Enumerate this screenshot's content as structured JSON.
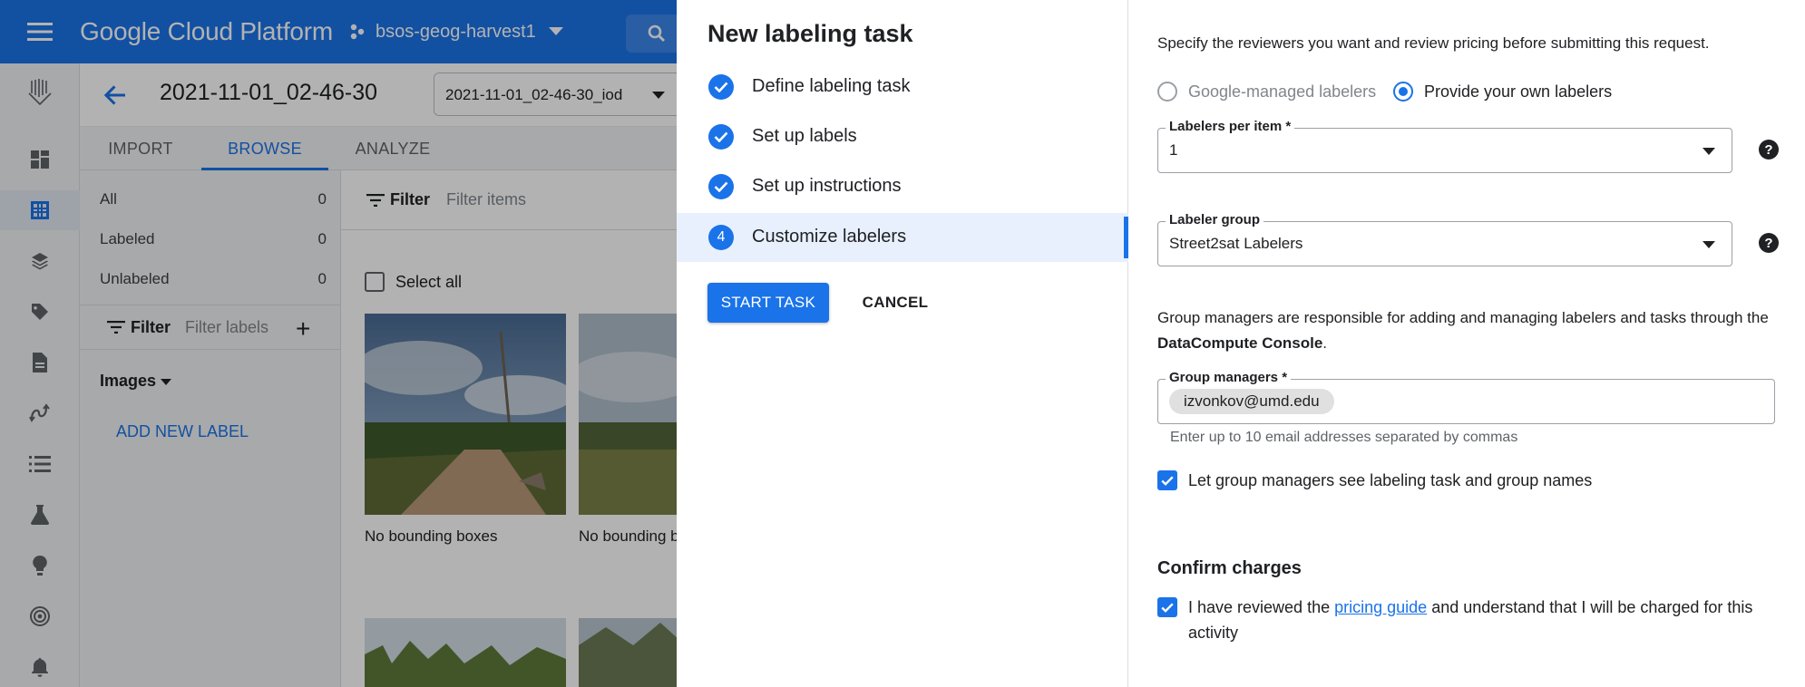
{
  "topbar": {
    "brand": "Google Cloud Platform",
    "project": "bsos-geog-harvest1"
  },
  "header": {
    "dataset_title": "2021-11-01_02-46-30",
    "dataset_select": "2021-11-01_02-46-30_iod"
  },
  "tabs": [
    {
      "label": "IMPORT"
    },
    {
      "label": "BROWSE"
    },
    {
      "label": "ANALYZE"
    }
  ],
  "counts": [
    {
      "label": "All",
      "value": "0"
    },
    {
      "label": "Labeled",
      "value": "0"
    },
    {
      "label": "Unlabeled",
      "value": "0"
    }
  ],
  "label_filter": {
    "title": "Filter",
    "placeholder": "Filter labels"
  },
  "images_label": "Images",
  "add_label": "ADD NEW LABEL",
  "content_filter": {
    "title": "Filter",
    "placeholder": "Filter items"
  },
  "select_all": "Select all",
  "captions": [
    "No bounding boxes",
    "No bounding b"
  ],
  "wizard": {
    "title": "New labeling task",
    "steps": [
      {
        "label": "Define labeling task"
      },
      {
        "label": "Set up labels"
      },
      {
        "label": "Set up instructions"
      },
      {
        "label": "Customize labelers",
        "number": "4"
      }
    ],
    "start": "START TASK",
    "cancel": "CANCEL"
  },
  "form": {
    "intro": "Specify the reviewers you want and review pricing before submitting this request.",
    "radio_google": "Google-managed labelers",
    "radio_own": "Provide your own labelers",
    "labelers_per_item": {
      "label": "Labelers per item *",
      "value": "1"
    },
    "labeler_group": {
      "label": "Labeler group",
      "value": "Street2sat Labelers"
    },
    "managers_text": "Group managers are responsible for adding and managing labelers and tasks through the",
    "managers_console": "DataCompute Console",
    "managers_end": ".",
    "group_managers": {
      "label": "Group managers *",
      "chip": "izvonkov@umd.edu"
    },
    "hint": "Enter up to 10 email addresses separated by commas",
    "let_managers": "Let group managers see labeling task and group names",
    "confirm_title": "Confirm charges",
    "confirm_pre": "I have reviewed the",
    "confirm_link": "pricing guide",
    "confirm_post": "and understand that I will be charged for this activity"
  },
  "colors": {
    "accent": "#1a73e8",
    "scrim": "rgba(0,0,0,0.30)"
  }
}
